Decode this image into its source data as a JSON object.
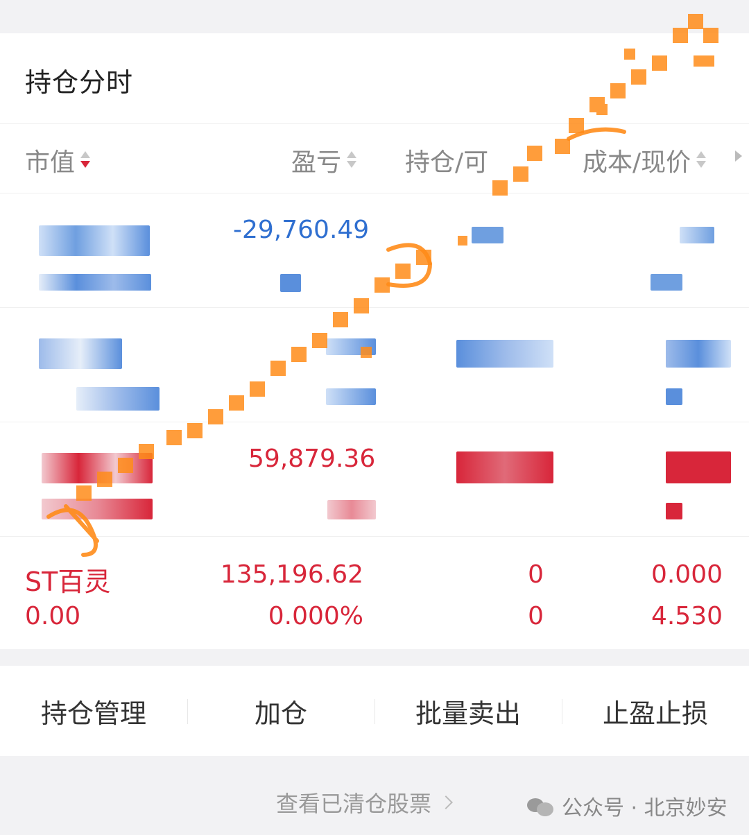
{
  "section_title": "持仓分时",
  "columns": {
    "market_value": "市值",
    "pnl": "盈亏",
    "position": "持仓/可",
    "cost_price": "成本/现价"
  },
  "rows": [
    {
      "pnl": "-29,760.49",
      "pnl_color": "#2f6fd0"
    },
    {
      "pnl": ""
    },
    {
      "pnl": "59,879.36",
      "pnl_color": "#d8263a"
    },
    {
      "name": "ST百灵",
      "market_value": "0.00",
      "pnl": "135,196.62",
      "pnl_pct": "0.000%",
      "position": "0",
      "available": "0",
      "cost": "0.000",
      "price": "4.530"
    }
  ],
  "actions": [
    "持仓管理",
    "加仓",
    "批量卖出",
    "止盈止损"
  ],
  "footer_link": "查看已清仓股票",
  "watermark": "公众号 · 北京妙安",
  "colors": {
    "up": "#d8263a",
    "down": "#2f6fd0",
    "accent": "#ff8c1a"
  }
}
